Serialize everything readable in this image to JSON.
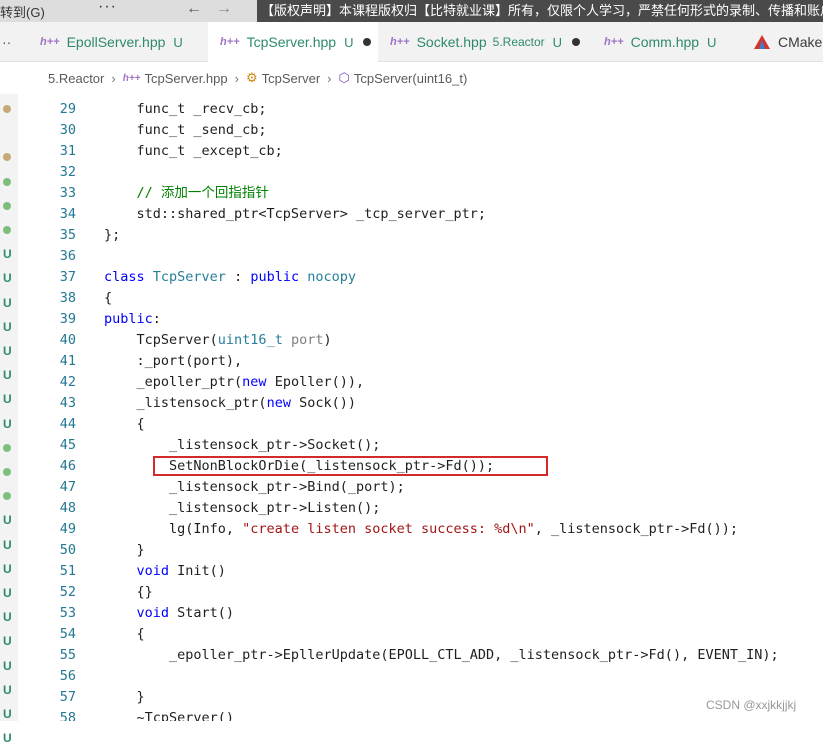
{
  "menubar": {
    "goto_label": "转到(G)",
    "more_label": "···",
    "back_icon": "arrow-left-icon",
    "forward_icon": "arrow-right-icon",
    "notice": "【版权声明】本课程版权归【比特就业课】所有，仅限个人学习，严禁任何形式的录制、传播和账户"
  },
  "tabs": [
    {
      "label": "EpollServer.hpp",
      "badge": "U",
      "dir": "",
      "dirty": false,
      "active": false
    },
    {
      "label": "TcpServer.hpp",
      "badge": "U",
      "dir": "",
      "dirty": true,
      "active": true
    },
    {
      "label": "Socket.hpp",
      "badge": "U",
      "dir": "5.Reactor",
      "dirty": true,
      "active": false
    },
    {
      "label": "Comm.hpp",
      "badge": "U",
      "dir": "",
      "dirty": false,
      "active": false
    },
    {
      "label": "CMake",
      "badge": "",
      "dir": "",
      "dirty": false,
      "active": false
    }
  ],
  "tab_icon_text": "h++",
  "breadcrumb": {
    "folder": "5.Reactor",
    "file": "TcpServer.hpp",
    "class": "TcpServer",
    "method": "TcpServer(uint16_t)"
  },
  "code_lines": [
    {
      "n": "29",
      "t": "    func_t _recv_cb;"
    },
    {
      "n": "30",
      "t": "    func_t _send_cb;"
    },
    {
      "n": "31",
      "t": "    func_t _except_cb;"
    },
    {
      "n": "32",
      "t": ""
    },
    {
      "n": "33",
      "t": "    // 添加一个回指指针"
    },
    {
      "n": "34",
      "t": "    std::shared_ptr<TcpServer> _tcp_server_ptr;"
    },
    {
      "n": "35",
      "t": "};"
    },
    {
      "n": "36",
      "t": ""
    },
    {
      "n": "37",
      "t": "class TcpServer : public nocopy"
    },
    {
      "n": "38",
      "t": "{"
    },
    {
      "n": "39",
      "t": "public:"
    },
    {
      "n": "40",
      "t": "    TcpServer(uint16_t port)"
    },
    {
      "n": "41",
      "t": "    :_port(port),"
    },
    {
      "n": "42",
      "t": "    _epoller_ptr(new Epoller()),"
    },
    {
      "n": "43",
      "t": "    _listensock_ptr(new Sock())"
    },
    {
      "n": "44",
      "t": "    {"
    },
    {
      "n": "45",
      "t": "        _listensock_ptr->Socket();"
    },
    {
      "n": "46",
      "t": "        SetNonBlockOrDie(_listensock_ptr->Fd());"
    },
    {
      "n": "47",
      "t": "        _listensock_ptr->Bind(_port);"
    },
    {
      "n": "48",
      "t": "        _listensock_ptr->Listen();"
    },
    {
      "n": "49",
      "t": "        lg(Info, \"create listen socket success: %d\\n\", _listensock_ptr->Fd());"
    },
    {
      "n": "50",
      "t": "    }"
    },
    {
      "n": "51",
      "t": "    void Init()"
    },
    {
      "n": "52",
      "t": "    {}"
    },
    {
      "n": "53",
      "t": "    void Start()"
    },
    {
      "n": "54",
      "t": "    {"
    },
    {
      "n": "55",
      "t": "        _epoller_ptr->EpllerUpdate(EPOLL_CTL_ADD, _listensock_ptr->Fd(), EVENT_IN);"
    },
    {
      "n": "56",
      "t": ""
    },
    {
      "n": "57",
      "t": "    }"
    },
    {
      "n": "58",
      "t": "    ~TcpServer()"
    }
  ],
  "gutter_marks": [
    "dot-tan",
    "",
    "dot-tan",
    "dot-green",
    "dot-green",
    "dot-green",
    "U",
    "U",
    "U",
    "U",
    "U",
    "U",
    "U",
    "U",
    "dot-green",
    "dot-green",
    "dot-green",
    "U",
    "U",
    "U",
    "U",
    "U",
    "U",
    "U",
    "U",
    "U",
    "U"
  ],
  "watermark": "CSDN @xxjkkjjkj",
  "colors": {
    "keyword": "#0000ff",
    "type": "#267f99",
    "comment": "#008000",
    "string": "#a31515",
    "highlight_border": "#d42a2a"
  }
}
